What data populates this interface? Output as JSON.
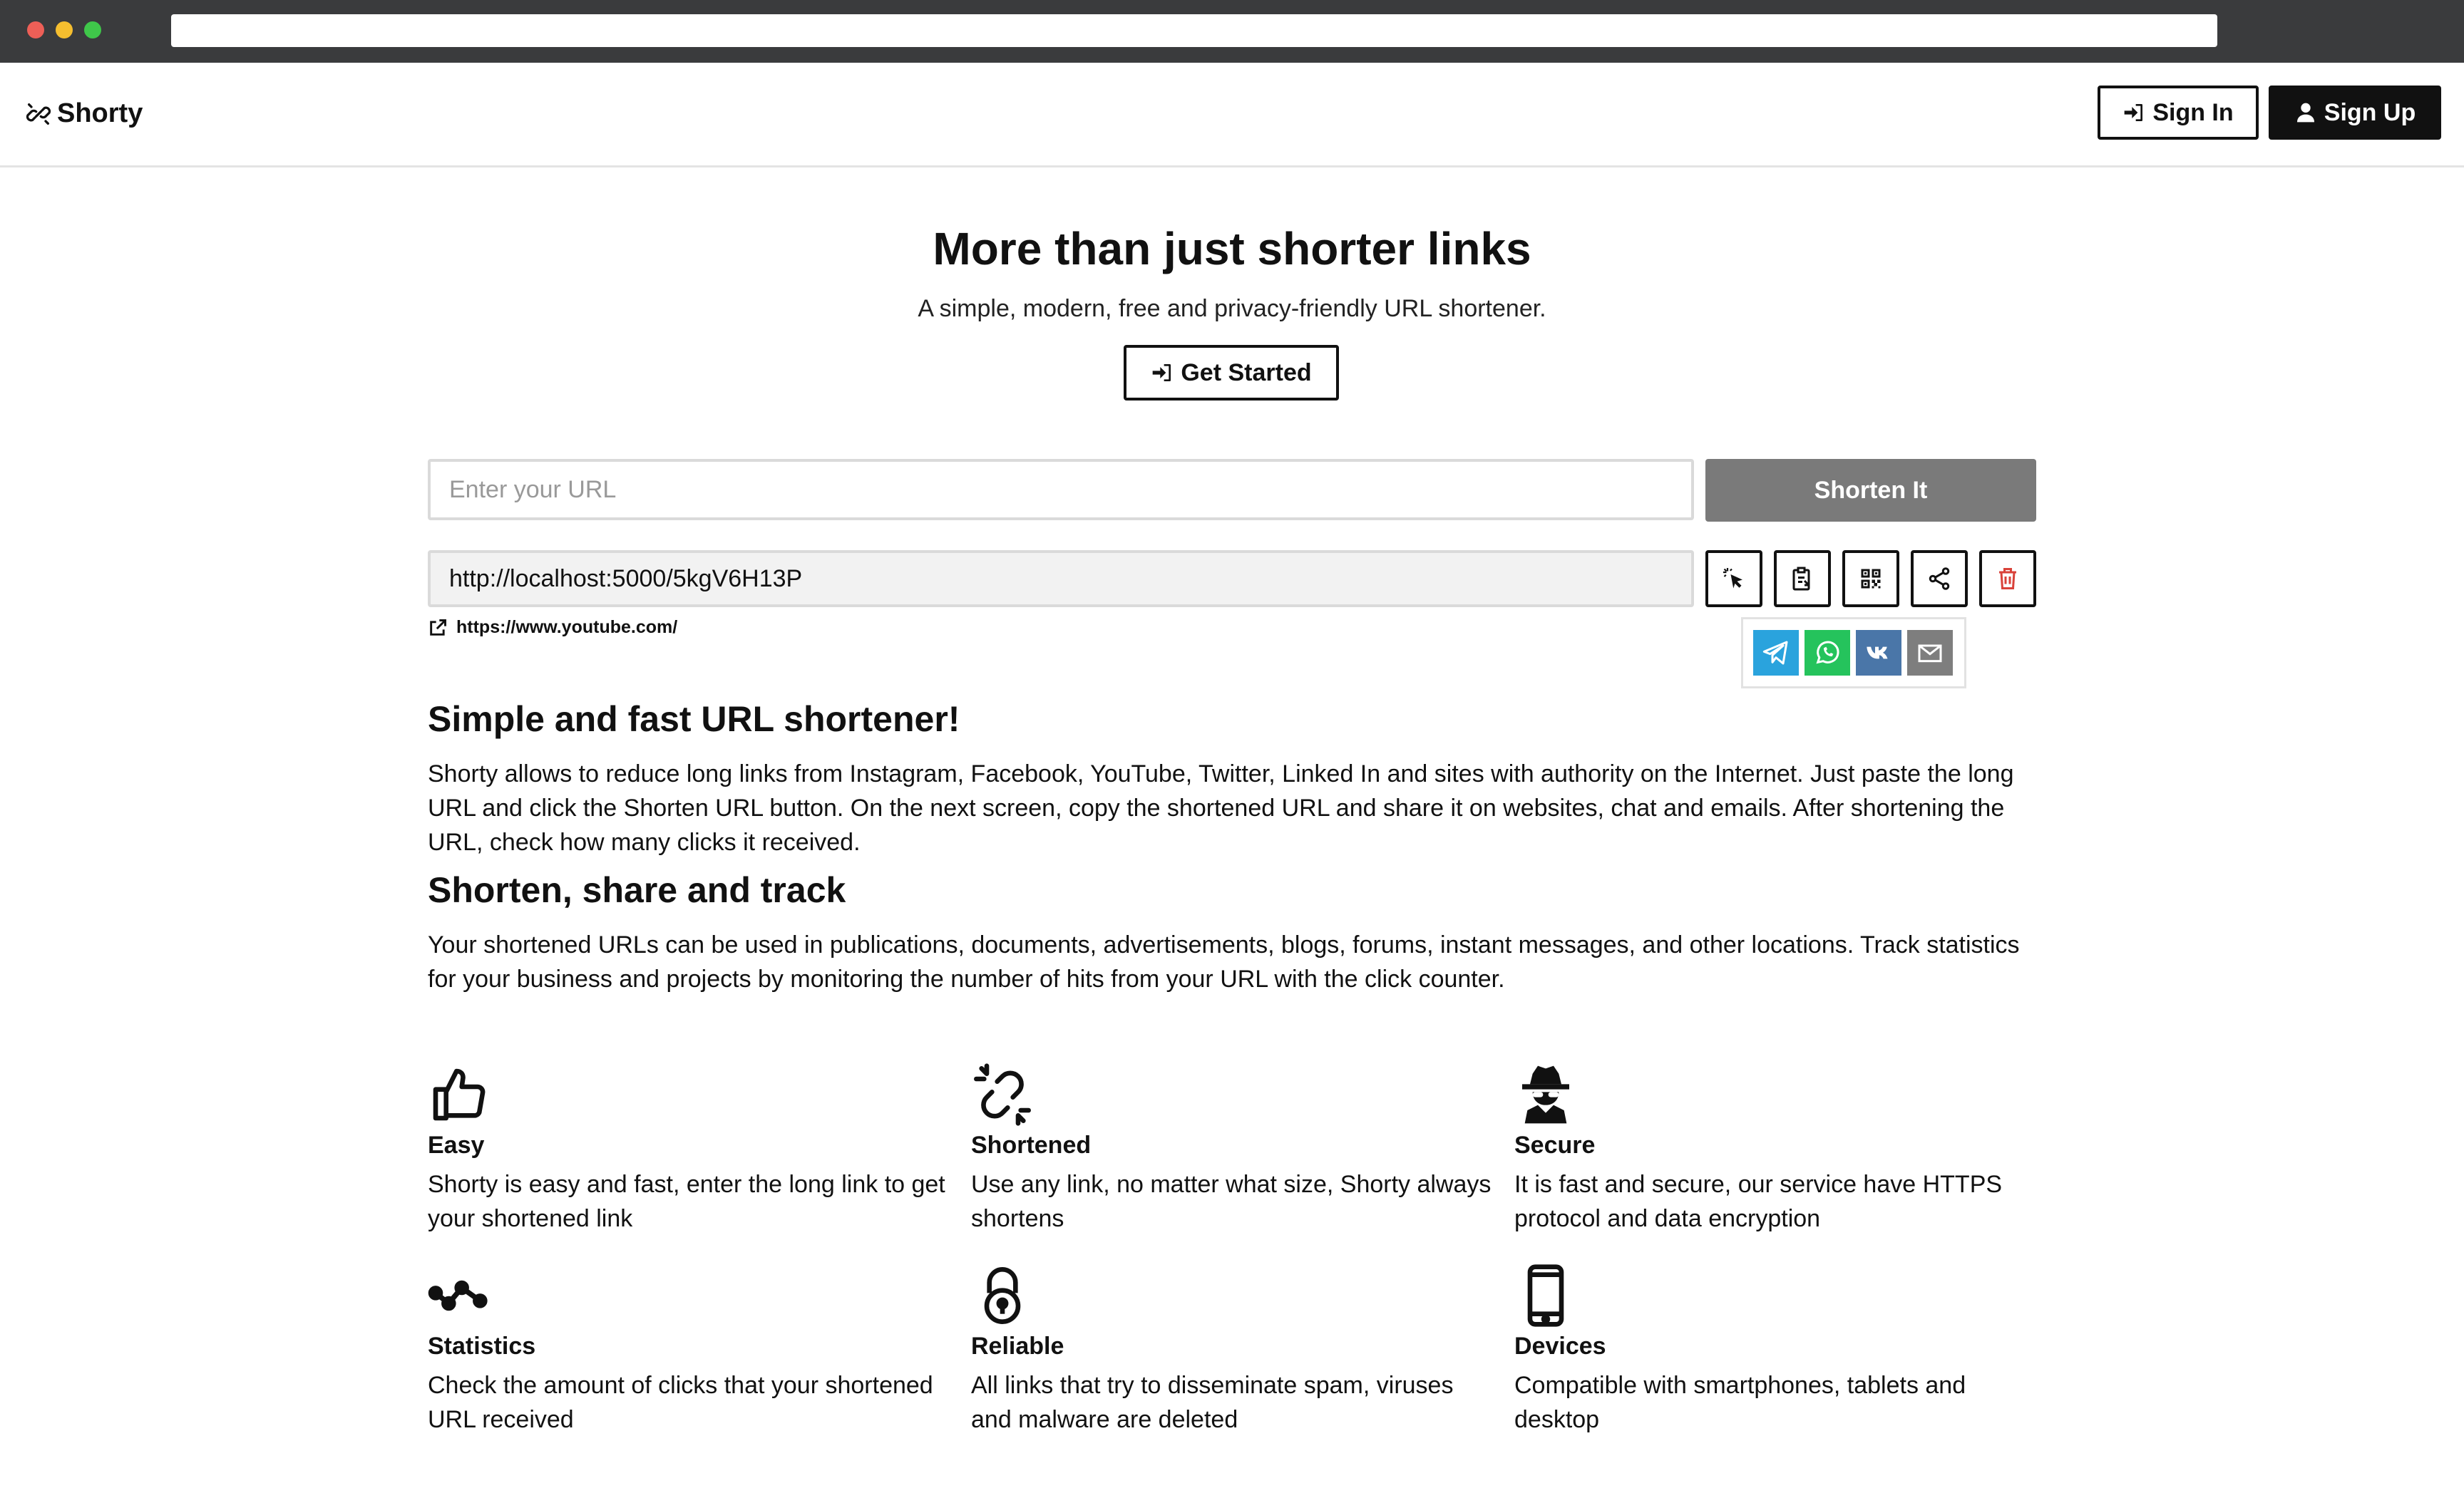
{
  "app": {
    "name": "Shorty"
  },
  "nav": {
    "sign_in": "Sign In",
    "sign_up": "Sign Up"
  },
  "hero": {
    "title": "More than just shorter links",
    "subtitle": "A simple, modern, free and privacy-friendly URL shortener.",
    "cta": "Get Started"
  },
  "shortener": {
    "input_placeholder": "Enter your URL",
    "input_value": "",
    "button": "Shorten It",
    "short_url": "http://localhost:5000/5kgV6H13P",
    "original_url": "https://www.youtube.com/",
    "actions": [
      "open-link",
      "copy",
      "qr-code",
      "share",
      "delete"
    ],
    "share_targets": [
      {
        "name": "Telegram",
        "color": "#2aa3dd"
      },
      {
        "name": "WhatsApp",
        "color": "#25c35c"
      },
      {
        "name": "VK",
        "color": "#4a76a8"
      },
      {
        "name": "Email",
        "color": "#7e7e7e"
      }
    ]
  },
  "content": {
    "sections": [
      {
        "heading": "Simple and fast URL shortener!",
        "body": "Shorty allows to reduce long links from Instagram, Facebook, YouTube, Twitter, Linked In and sites with authority on the Internet. Just paste the long URL and click the Shorten URL button. On the next screen, copy the shortened URL and share it on websites, chat and emails. After shortening the URL, check how many clicks it received."
      },
      {
        "heading": "Shorten, share and track",
        "body": "Your shortened URLs can be used in publications, documents, advertisements, blogs, forums, instant messages, and other locations. Track statistics for your business and projects by monitoring the number of hits from your URL with the click counter."
      }
    ]
  },
  "features": [
    {
      "icon": "thumbs-up-icon",
      "title": "Easy",
      "desc": "Shorty is easy and fast, enter the long link to get your shortened link"
    },
    {
      "icon": "broken-link-icon",
      "title": "Shortened",
      "desc": "Use any link, no matter what size, Shorty always shortens"
    },
    {
      "icon": "spy-icon",
      "title": "Secure",
      "desc": "It is fast and secure, our service have HTTPS protocol and data encryption"
    },
    {
      "icon": "stats-icon",
      "title": "Statistics",
      "desc": "Check the amount of clicks that your shortened URL received"
    },
    {
      "icon": "lock-icon",
      "title": "Reliable",
      "desc": "All links that try to disseminate spam, viruses and malware are deleted"
    },
    {
      "icon": "phone-icon",
      "title": "Devices",
      "desc": "Compatible with smartphones, tablets and desktop"
    }
  ],
  "colors": {
    "primary": "#111111",
    "shorten_button": "#7a7a7a",
    "delete": "#d9423a"
  }
}
